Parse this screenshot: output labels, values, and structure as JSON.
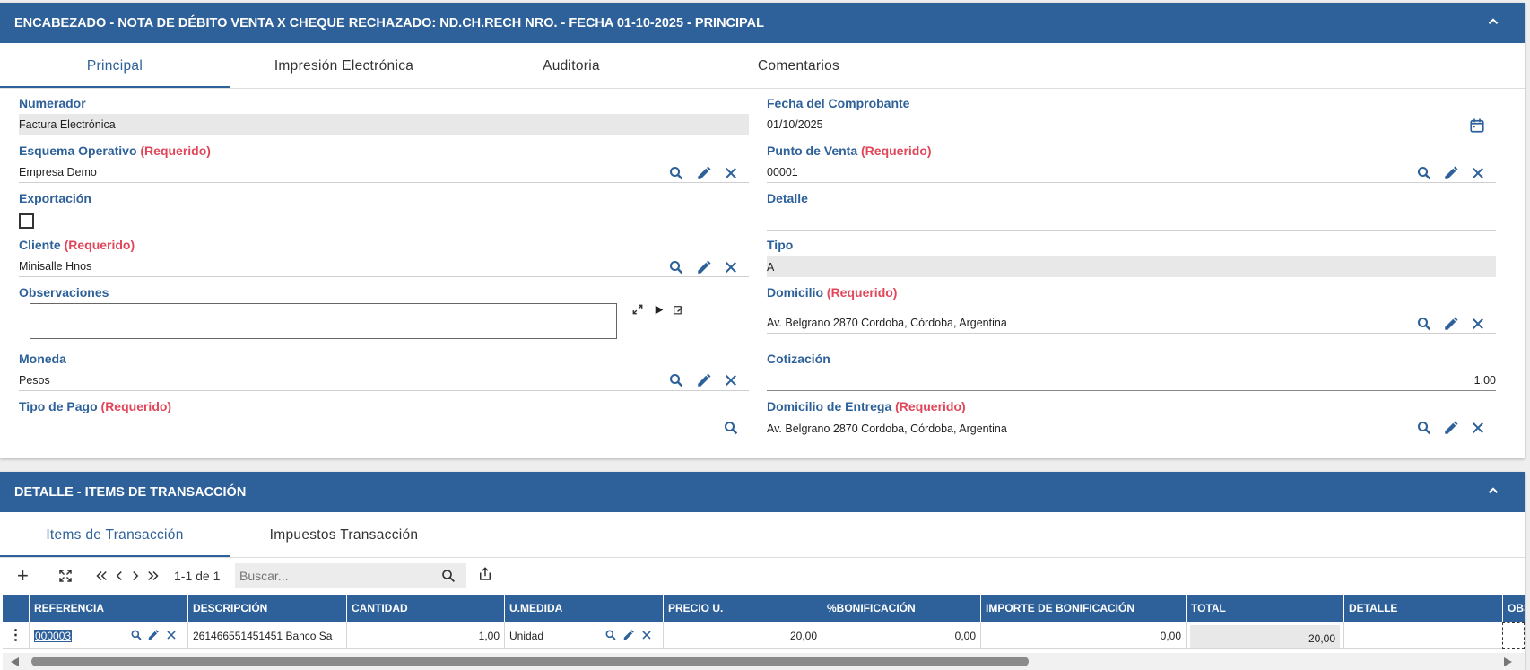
{
  "header_panel": {
    "title": "ENCABEZADO - NOTA DE DÉBITO VENTA X CHEQUE RECHAZADO: ND.CH.RECH NRO. - FECHA 01-10-2025 - PRINCIPAL",
    "tabs": [
      "Principal",
      "Impresión Electrónica",
      "Auditoria",
      "Comentarios"
    ],
    "required_text": "(Requerido)",
    "fields": {
      "numerador": {
        "label": "Numerador",
        "value": "Factura Electrónica"
      },
      "fecha": {
        "label": "Fecha del Comprobante",
        "value": "01/10/2025"
      },
      "esquema": {
        "label": "Esquema Operativo",
        "value": "Empresa Demo"
      },
      "punto_venta": {
        "label": "Punto de Venta",
        "value": "00001"
      },
      "exportacion": {
        "label": "Exportación"
      },
      "detalle": {
        "label": "Detalle",
        "value": ""
      },
      "cliente": {
        "label": "Cliente",
        "value": "Minisalle Hnos"
      },
      "tipo": {
        "label": "Tipo",
        "value": "A"
      },
      "observaciones": {
        "label": "Observaciones",
        "value": ""
      },
      "domicilio": {
        "label": "Domicilio",
        "value": "Av. Belgrano 2870  Cordoba, Córdoba, Argentina"
      },
      "moneda": {
        "label": "Moneda",
        "value": "Pesos"
      },
      "cotizacion": {
        "label": "Cotización",
        "value": "1,00"
      },
      "tipo_pago": {
        "label": "Tipo de Pago",
        "value": ""
      },
      "domicilio_entrega": {
        "label": "Domicilio de Entrega",
        "value": "Av. Belgrano 2870  Cordoba, Córdoba, Argentina"
      }
    }
  },
  "detail_panel": {
    "title": "DETALLE - ITEMS DE TRANSACCIÓN",
    "tabs": [
      "Items de Transacción",
      "Impuestos Transacción"
    ],
    "toolbar": {
      "add_label": "+",
      "pager": "1-1 de 1",
      "search_placeholder": "Buscar..."
    },
    "columns": [
      "REFERENCIA",
      "DESCRIPCIÓN",
      "CANTIDAD",
      "U.MEDIDA",
      "PRECIO U.",
      "%BONIFICACIÓN",
      "IMPORTE DE BONIFICACIÓN",
      "TOTAL",
      "DETALLE",
      "OBS"
    ],
    "row": {
      "referencia": "000003",
      "descripcion": "261466551451451 Banco Sa",
      "cantidad": "1,00",
      "umedida": "Unidad",
      "precio": "20,00",
      "bonif_pct": "0,00",
      "importe_bonif": "0,00",
      "total": "20,00",
      "detalle": ""
    }
  },
  "colors": {
    "primary": "#2e6199",
    "required": "#e0475a",
    "background": "#eeeeee"
  }
}
